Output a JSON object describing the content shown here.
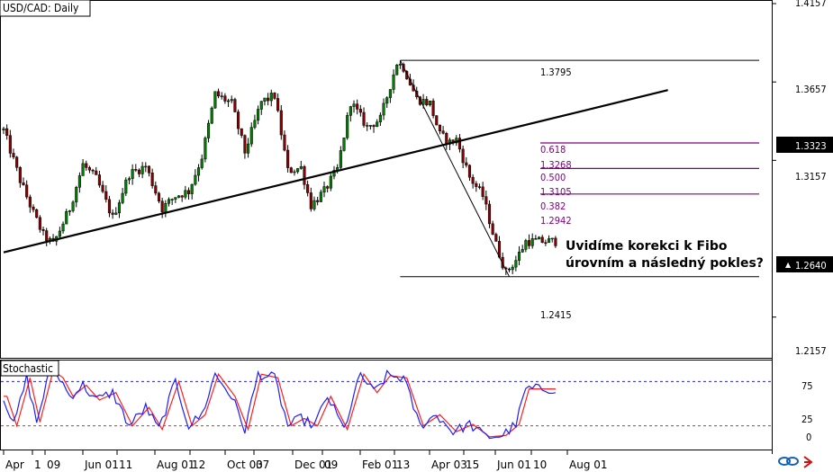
{
  "chart_data": {
    "type": "candlestick",
    "title": "USD/CAD: Daily",
    "price_axis": {
      "range": [
        1.192,
        1.4157
      ],
      "ticks": [
        "1.4157",
        "1.3657",
        "1.3157",
        "1.2157"
      ],
      "markers": [
        {
          "label": "1.3323",
          "value": 1.3323
        },
        {
          "label": "1.2640",
          "value": 1.264
        }
      ]
    },
    "x_ticks": [
      "Apr",
      "1",
      "09",
      "Jun 01",
      "11",
      "Aug 01",
      "12",
      "Oct 03",
      "07",
      "Dec 01",
      "09",
      "Feb 01",
      "13",
      "Apr 03",
      "15",
      "Jun 01",
      "10",
      "Aug 01"
    ],
    "candle_count": 168,
    "swing_points": [
      {
        "i": 0,
        "v": 1.335
      },
      {
        "i": 5,
        "v": 1.303
      },
      {
        "i": 9,
        "v": 1.282
      },
      {
        "i": 12,
        "v": 1.268
      },
      {
        "i": 15,
        "v": 1.262
      },
      {
        "i": 20,
        "v": 1.285
      },
      {
        "i": 24,
        "v": 1.313
      },
      {
        "i": 28,
        "v": 1.304
      },
      {
        "i": 33,
        "v": 1.279
      },
      {
        "i": 38,
        "v": 1.307
      },
      {
        "i": 43,
        "v": 1.312
      },
      {
        "i": 48,
        "v": 1.285
      },
      {
        "i": 52,
        "v": 1.293
      },
      {
        "i": 56,
        "v": 1.296
      },
      {
        "i": 60,
        "v": 1.318
      },
      {
        "i": 64,
        "v": 1.358
      },
      {
        "i": 69,
        "v": 1.352
      },
      {
        "i": 73,
        "v": 1.321
      },
      {
        "i": 78,
        "v": 1.353
      },
      {
        "i": 82,
        "v": 1.357
      },
      {
        "i": 86,
        "v": 1.309
      },
      {
        "i": 90,
        "v": 1.311
      },
      {
        "i": 93,
        "v": 1.287
      },
      {
        "i": 97,
        "v": 1.296
      },
      {
        "i": 101,
        "v": 1.31
      },
      {
        "i": 105,
        "v": 1.353
      },
      {
        "i": 110,
        "v": 1.337
      },
      {
        "i": 114,
        "v": 1.342
      },
      {
        "i": 119,
        "v": 1.378
      },
      {
        "i": 121,
        "v": 1.375
      },
      {
        "i": 125,
        "v": 1.355
      },
      {
        "i": 129,
        "v": 1.352
      },
      {
        "i": 132,
        "v": 1.332
      },
      {
        "i": 135,
        "v": 1.327
      },
      {
        "i": 137,
        "v": 1.329
      },
      {
        "i": 141,
        "v": 1.305
      },
      {
        "i": 145,
        "v": 1.293
      },
      {
        "i": 149,
        "v": 1.262
      },
      {
        "i": 152,
        "v": 1.244
      },
      {
        "i": 155,
        "v": 1.252
      },
      {
        "i": 158,
        "v": 1.264
      }
    ],
    "trendline": {
      "from": {
        "i": 0,
        "v": 1.257
      },
      "to": {
        "i": 201,
        "v": 1.3605
      }
    },
    "fib_levels": [
      {
        "ratio": "0.618",
        "value": "1.3268"
      },
      {
        "ratio": "0.500",
        "value": "1.3105"
      },
      {
        "ratio": "0.382",
        "value": "1.2942"
      }
    ],
    "swing_high": {
      "value": "1.3795",
      "price": 1.3795
    },
    "swing_low": {
      "value": "1.2415",
      "price": 1.2415
    },
    "annotation": {
      "line1": "Uvidíme korekci k Fibo",
      "line2": "úrovním a následný pokles?"
    },
    "stochastic": {
      "label": "Stochastic",
      "ticks": [
        "75",
        "25",
        "0"
      ],
      "levels": [
        80,
        20
      ],
      "swing_points": [
        {
          "i": 0,
          "v": 60
        },
        {
          "i": 3,
          "v": 20
        },
        {
          "i": 7,
          "v": 85
        },
        {
          "i": 10,
          "v": 25
        },
        {
          "i": 14,
          "v": 95
        },
        {
          "i": 17,
          "v": 85
        },
        {
          "i": 20,
          "v": 60
        },
        {
          "i": 24,
          "v": 75
        },
        {
          "i": 28,
          "v": 55
        },
        {
          "i": 33,
          "v": 65
        },
        {
          "i": 38,
          "v": 20
        },
        {
          "i": 43,
          "v": 45
        },
        {
          "i": 47,
          "v": 15
        },
        {
          "i": 52,
          "v": 80
        },
        {
          "i": 56,
          "v": 20
        },
        {
          "i": 60,
          "v": 35
        },
        {
          "i": 64,
          "v": 90
        },
        {
          "i": 69,
          "v": 60
        },
        {
          "i": 73,
          "v": 15
        },
        {
          "i": 77,
          "v": 90
        },
        {
          "i": 82,
          "v": 85
        },
        {
          "i": 86,
          "v": 20
        },
        {
          "i": 90,
          "v": 30
        },
        {
          "i": 94,
          "v": 20
        },
        {
          "i": 98,
          "v": 60
        },
        {
          "i": 103,
          "v": 15
        },
        {
          "i": 108,
          "v": 90
        },
        {
          "i": 112,
          "v": 65
        },
        {
          "i": 116,
          "v": 88
        },
        {
          "i": 121,
          "v": 85
        },
        {
          "i": 126,
          "v": 20
        },
        {
          "i": 131,
          "v": 35
        },
        {
          "i": 136,
          "v": 12
        },
        {
          "i": 141,
          "v": 22
        },
        {
          "i": 146,
          "v": 5
        },
        {
          "i": 151,
          "v": 7
        },
        {
          "i": 155,
          "v": 22
        },
        {
          "i": 158,
          "v": 70
        }
      ]
    },
    "colors": {
      "bull": "#008000",
      "bear": "#8b0000",
      "fib": "#800080",
      "k": "#1e1eff",
      "d": "#ff1e1e"
    }
  }
}
